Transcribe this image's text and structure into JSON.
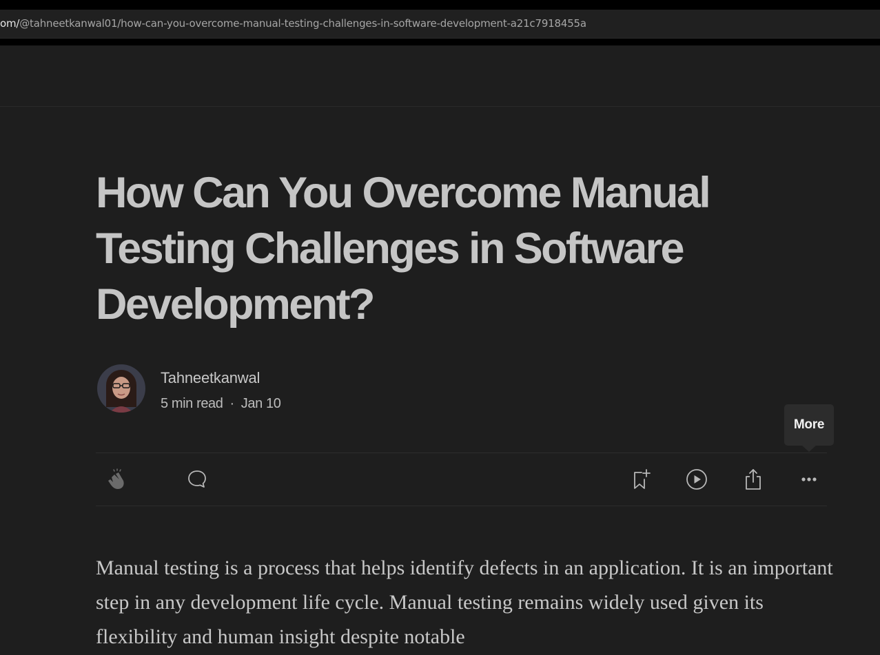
{
  "browser": {
    "url_host": "om/",
    "url_path": "@tahneetkanwal01/how-can-you-overcome-manual-testing-challenges-in-software-development-a21c7918455a"
  },
  "article": {
    "title": "How Can You Overcome Manual Testing Challenges in Software Development?",
    "author": "Tahneetkanwal",
    "read_time": "5 min read",
    "separator": "·",
    "date": "Jan 10",
    "body": "Manual testing is a process that helps identify defects in an application. It is an important step in any development life cycle. Manual testing remains widely used given its flexibility and human insight despite notable"
  },
  "actions": {
    "clap_icon": "clap-icon",
    "comment_icon": "comment-icon",
    "save_icon": "bookmark-add-icon",
    "listen_icon": "play-circle-icon",
    "share_icon": "share-icon",
    "more_icon": "more-dots-icon"
  },
  "tooltip": {
    "label": "More"
  },
  "colors": {
    "page_bg": "#1e1e1e",
    "title": "#c5c5c5",
    "text": "#c8c8c8",
    "icon": "#b8b8b8"
  }
}
